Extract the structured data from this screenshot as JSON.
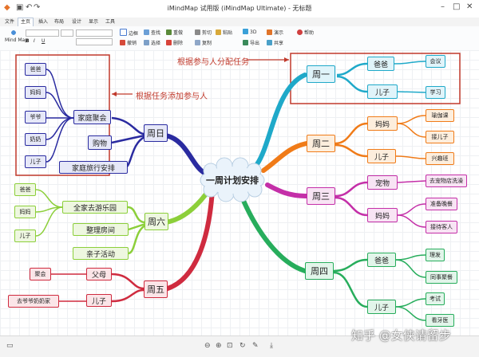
{
  "app": {
    "title": "iMindMap 试用版 (iMindMap Ultimate) - 无标题"
  },
  "tabs": [
    "文件",
    "主页",
    "插入",
    "布局",
    "设计",
    "显示",
    "工具"
  ],
  "ribbon": {
    "view_mode": "Mind Map",
    "items": [
      "边框",
      "撤销",
      "查找",
      "选择",
      "删除",
      "重做",
      "剪切",
      "粘贴",
      "复制",
      "3D",
      "演示",
      "导出",
      "共享",
      "帮助"
    ]
  },
  "map": {
    "central": "一周计划安排",
    "branches": {
      "sun": "周日",
      "sat": "周六",
      "fri": "周五",
      "mon": "周一",
      "tue": "周二",
      "wed": "周三",
      "thu": "周四"
    },
    "sun": {
      "sub": [
        "家庭聚会",
        "购物",
        "家庭旅行安排"
      ],
      "leaves": [
        "爸爸",
        "妈妈",
        "爷爷",
        "奶奶",
        "儿子"
      ]
    },
    "sat": {
      "sub": [
        "全家去游乐园",
        "整理房间",
        "亲子活动"
      ],
      "leaves": [
        "爸爸",
        "妈妈",
        "儿子"
      ]
    },
    "fri": {
      "sub": [
        "父母",
        "儿子"
      ],
      "leaves": [
        "聚会",
        "去爷爷奶奶家"
      ]
    },
    "mon": {
      "sub": [
        "爸爸",
        "儿子"
      ],
      "leaves": [
        "会议",
        "学习"
      ]
    },
    "tue": {
      "sub": [
        "妈妈",
        "儿子"
      ],
      "leaves": [
        "瑜伽课",
        "接儿子",
        "兴趣班"
      ]
    },
    "wed": {
      "sub": [
        "宠物",
        "妈妈"
      ],
      "leaves": [
        "去宠物店洗澡",
        "准备晚餐",
        "接待客人"
      ]
    },
    "thu": {
      "sub": [
        "爸爸",
        "儿子"
      ],
      "leaves": [
        "理发",
        "同事聚餐",
        "考试",
        "看牙医"
      ]
    }
  },
  "annotations": {
    "top": "根据参与人分配任务",
    "left": "根据任务添加参与人"
  },
  "watermark": "知乎 @女侠请留步",
  "colors": {
    "sun": "#2a2ba0",
    "sat": "#8ccf3a",
    "fri": "#cf2b3f",
    "mon": "#1fa9c9",
    "tue": "#f07b18",
    "wed": "#c42fa8",
    "thu": "#27ad5c",
    "annotation": "#c0392b"
  }
}
